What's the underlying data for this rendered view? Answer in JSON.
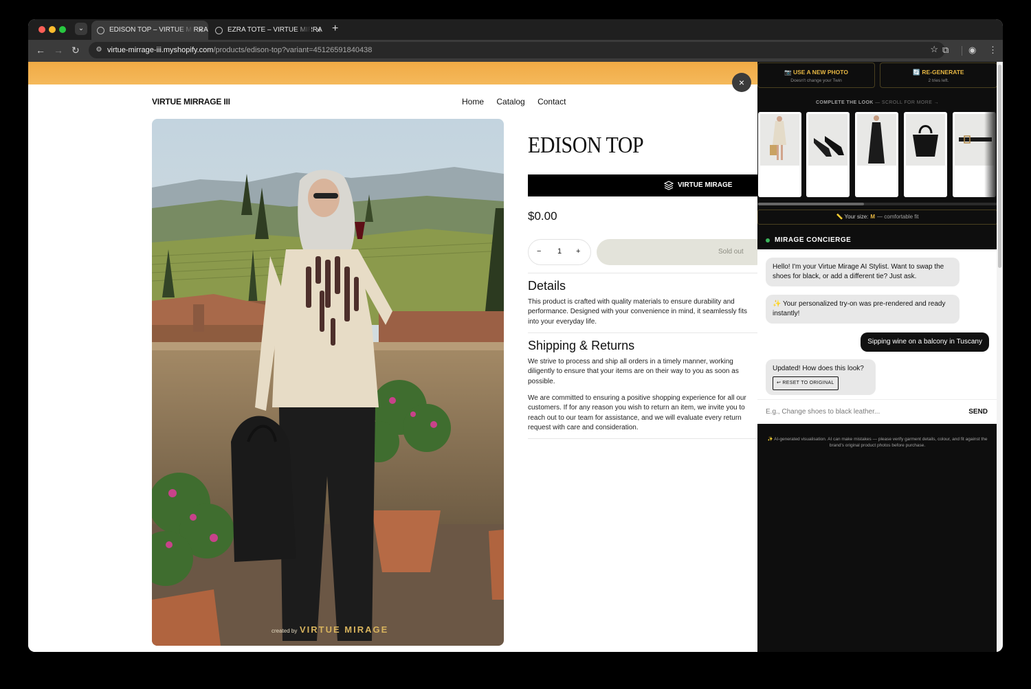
{
  "browser": {
    "tabs": [
      {
        "label": "EDISON TOP – VIRTUE MIRRA",
        "close": "×"
      },
      {
        "label": "EZRA TOTE – VIRTUE MIRRA",
        "close": "×"
      }
    ],
    "new_tab": "+",
    "url_host": "virtue-mirrage-iii.myshopify.com",
    "url_path": "/products/edison-top?variant=45126591840438"
  },
  "store": {
    "brand": "VIRTUE MIRRAGE III",
    "nav": [
      "Home",
      "Catalog",
      "Contact"
    ],
    "image_watermark": {
      "prefix": "created by",
      "name": "VIRTUE MIRAGE"
    }
  },
  "product": {
    "title": "EDISON TOP",
    "vm_button": "VIRTUE MIRAGE",
    "price": "$0.00",
    "quantity": {
      "minus": "−",
      "value": "1",
      "plus": "+"
    },
    "sold_out": "Sold out",
    "details_heading": "Details",
    "details_text": "This product is crafted with quality materials to ensure durability and performance. Designed with your convenience in mind, it seamlessly fits into your everyday life.",
    "shipping_heading": "Shipping & Returns",
    "shipping_p1": "We strive to process and ship all orders in a timely manner, working diligently to ensure that your items are on their way to you as soon as possible.",
    "shipping_p2": "We are committed to ensuring a positive shopping experience for all our customers. If for any reason you wish to return an item, we invite you to reach out to our team for assistance, and we will evaluate every return request with care and consideration."
  },
  "overlay_close": "×",
  "panel": {
    "use_new_photo": {
      "label": "📷 USE A NEW PHOTO",
      "sub": "Doesn't change your Twin"
    },
    "regenerate": {
      "label": "🔄 RE-GENERATE",
      "sub": "2 tries left."
    },
    "complete_look": "COMPLETE THE LOOK",
    "scroll_more": "— SCROLL FOR MORE →",
    "products": [
      "tan-dress-with-basket",
      "black-heels",
      "black-strapless-dress",
      "black-tote-bag",
      "black-belt"
    ],
    "size_label": "📏 Your size:",
    "size_value": "M",
    "size_note": "— comfortable fit",
    "concierge_title": "MIRAGE CONCIERGE",
    "messages": [
      {
        "from": "bot",
        "text": "Hello! I'm your Virtue Mirage AI Stylist. Want to swap the shoes for black, or add a different tie? Just ask."
      },
      {
        "from": "bot",
        "text": "✨ Your personalized try-on was pre-rendered and ready instantly!"
      },
      {
        "from": "user",
        "text": "Sipping wine on a balcony in Tuscany"
      },
      {
        "from": "bot",
        "text": "Updated! How does this look?",
        "action": "↩ RESET TO ORIGINAL"
      }
    ],
    "input_placeholder": "E.g., Change shoes to black leather...",
    "send": "SEND",
    "disclaimer": "✨ AI-generated visualisation. AI can make mistakes — please verify garment details, colour, and fit against the brand's original product photos before purchase."
  },
  "colors": {
    "accent_gold": "#e7b743",
    "banner": "#f0aa45",
    "panel_bg": "#0e0e0e"
  }
}
